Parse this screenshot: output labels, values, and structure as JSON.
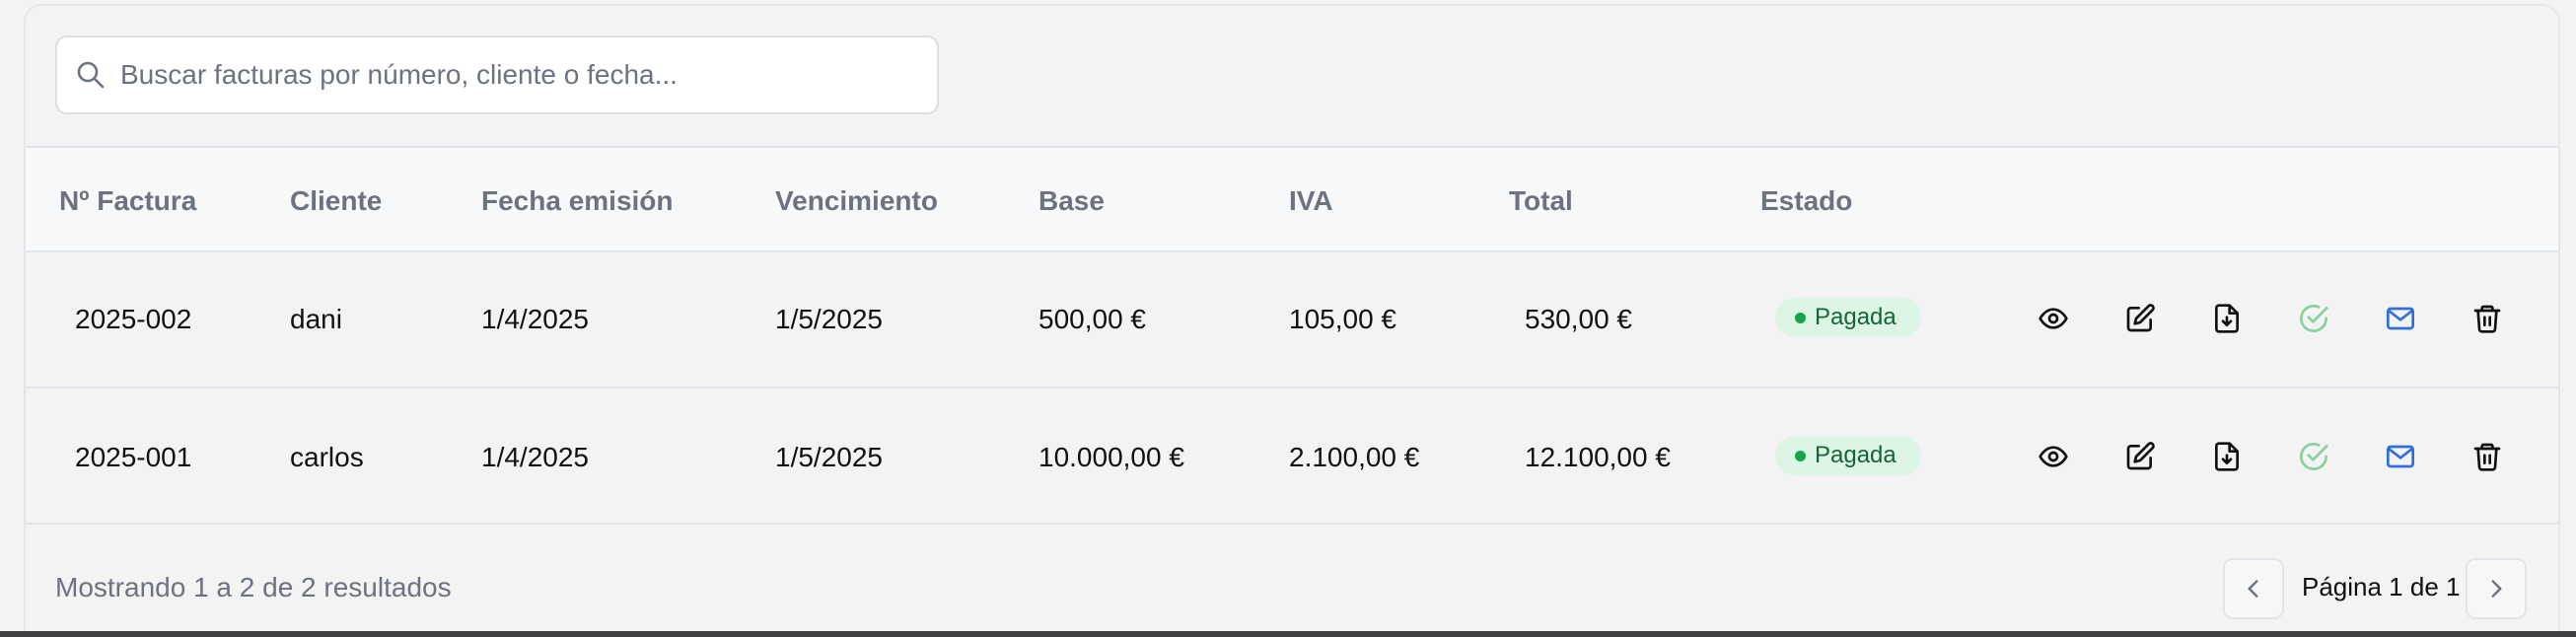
{
  "search": {
    "placeholder": "Buscar facturas por número, cliente o fecha...",
    "value": ""
  },
  "table": {
    "headers": {
      "number": "Nº Factura",
      "client": "Cliente",
      "issue_date": "Fecha emisión",
      "due_date": "Vencimiento",
      "base": "Base",
      "vat": "IVA",
      "total": "Total",
      "status": "Estado"
    },
    "rows": [
      {
        "number": "2025-002",
        "client": "dani",
        "issue_date": "1/4/2025",
        "due_date": "1/5/2025",
        "base": "500,00 €",
        "vat": "105,00 €",
        "total": "530,00 €",
        "status": "Pagada"
      },
      {
        "number": "2025-001",
        "client": "carlos",
        "issue_date": "1/4/2025",
        "due_date": "1/5/2025",
        "base": "10.000,00 €",
        "vat": "2.100,00 €",
        "total": "12.100,00 €",
        "status": "Pagada"
      }
    ],
    "actions": [
      "eye-icon",
      "edit-icon",
      "file-download-icon",
      "check-circle-icon",
      "mail-icon",
      "trash-icon"
    ]
  },
  "footer": {
    "summary": "Mostrando 1 a 2 de 2 resultados",
    "page_label": "Página 1 de 1"
  },
  "colors": {
    "status_paid_bg": "#dcf5e4",
    "status_paid_text": "#166534",
    "check_green": "#86d19c",
    "mail_blue": "#2f6fdb"
  }
}
